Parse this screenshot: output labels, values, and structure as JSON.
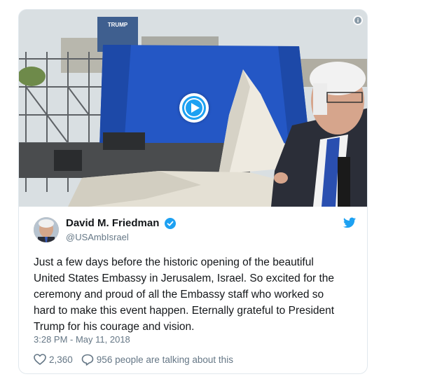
{
  "tweet": {
    "author": {
      "display_name": "David M. Friedman",
      "handle": "@USAmbIsrael",
      "verified": true
    },
    "text": "Just a few days before the historic opening of the beautiful\nUnited States Embassy in Jerusalem, Israel. So excited for the\nceremony and proud of all the Embassy staff who worked so\nhard to make this event happen.  Eternally grateful to President\nTrump for his courage and vision.",
    "timestamp": "3:28 PM - May 11, 2018",
    "likes": "2,360",
    "replies_label": "956 people are talking about this"
  },
  "media": {
    "type": "video",
    "billboard_text": "TRUMP"
  },
  "icons": {
    "info": "info-icon",
    "play": "play-icon",
    "verified": "verified-badge-icon",
    "brand": "twitter-bird-icon",
    "like": "heart-icon",
    "reply": "speech-bubble-icon"
  },
  "colors": {
    "brand_blue": "#1da1f2",
    "text": "#14171a",
    "muted": "#657786",
    "border": "#e1e8ed"
  }
}
